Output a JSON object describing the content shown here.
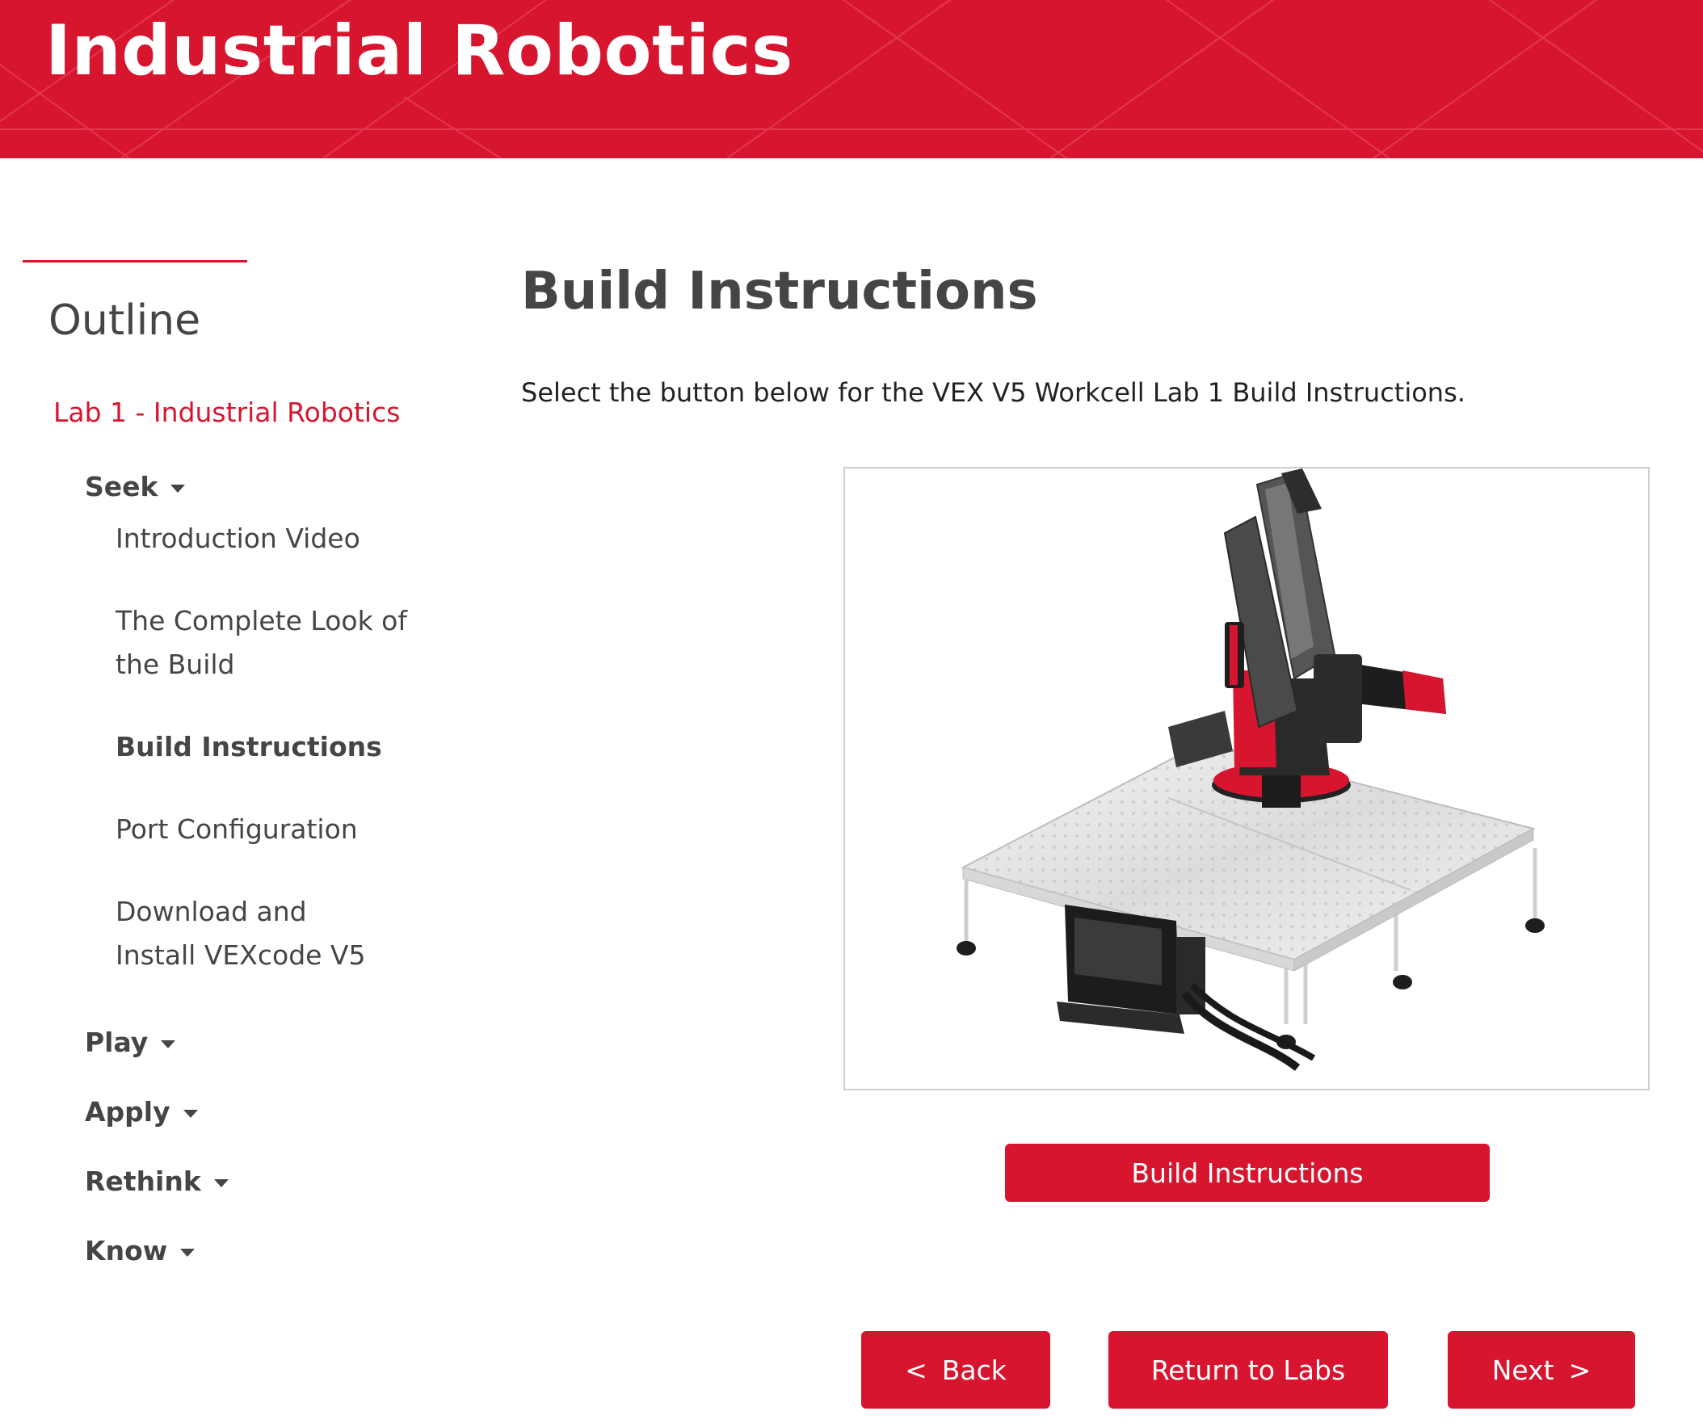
{
  "header": {
    "title": "Industrial Robotics",
    "brand_color": "#d7152f"
  },
  "sidebar": {
    "heading": "Outline",
    "lab_link": "Lab 1 - Industrial Robotics",
    "sections": [
      {
        "label": "Seek",
        "expanded": true,
        "icon": "caret-down-icon"
      },
      {
        "label": "Play",
        "expanded": false,
        "icon": "caret-down-icon"
      },
      {
        "label": "Apply",
        "expanded": false,
        "icon": "caret-down-icon"
      },
      {
        "label": "Rethink",
        "expanded": false,
        "icon": "caret-down-icon"
      },
      {
        "label": "Know",
        "expanded": false,
        "icon": "caret-down-icon"
      }
    ],
    "seek_items": [
      {
        "label": "Introduction Video",
        "active": false
      },
      {
        "label": "The Complete Look of the Build",
        "active": false
      },
      {
        "label": "Build Instructions",
        "active": true
      },
      {
        "label": "Port Configuration",
        "active": false
      },
      {
        "label": "Download and Install VEXcode V5",
        "active": false
      }
    ]
  },
  "main": {
    "title": "Build Instructions",
    "intro": "Select the button below for the VEX V5 Workcell Lab 1 Build Instructions.",
    "build_button": "Build Instructions"
  },
  "navigation": {
    "back_chevron": "<",
    "back": "Back",
    "return": "Return to Labs",
    "next": "Next",
    "next_chevron": ">"
  }
}
